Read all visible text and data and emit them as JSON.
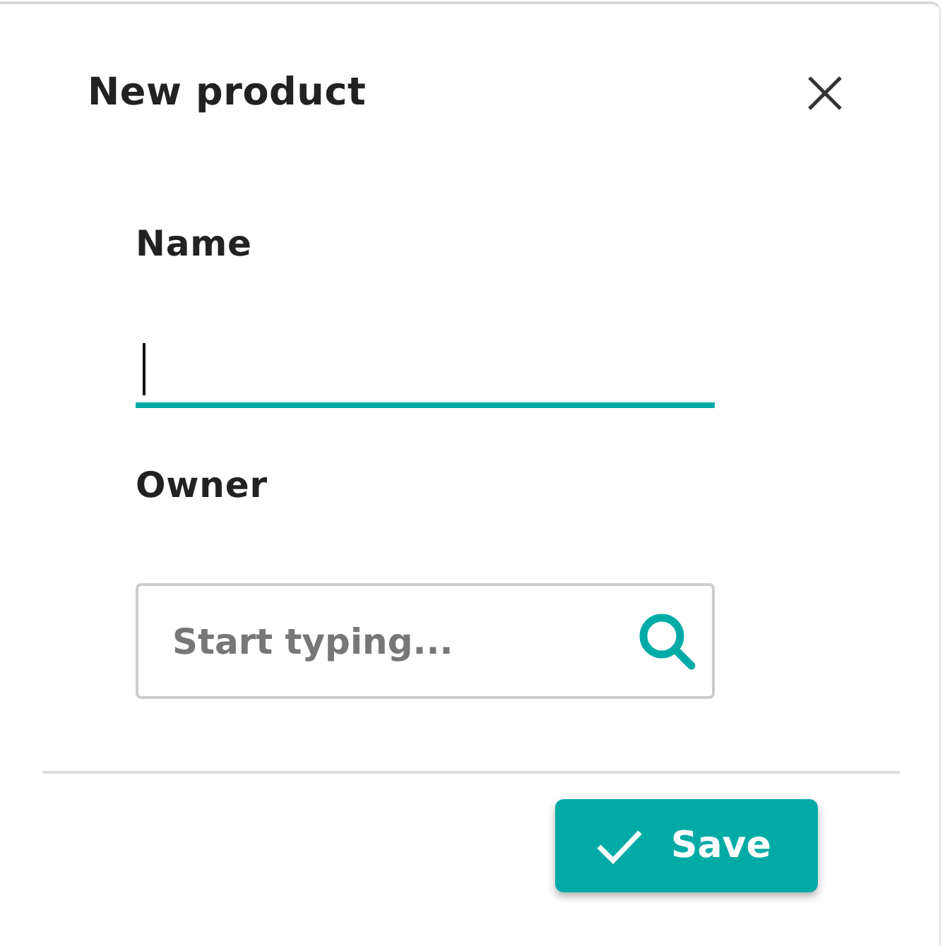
{
  "dialog": {
    "title": "New product"
  },
  "fields": [
    {
      "kind": "text",
      "label": "Name",
      "focused": true
    },
    {
      "kind": "search",
      "label": "Owner",
      "placeholder": "Start typing...",
      "focused": false
    }
  ],
  "buttons": [
    {
      "kind": "save",
      "label": "Save"
    }
  ]
}
